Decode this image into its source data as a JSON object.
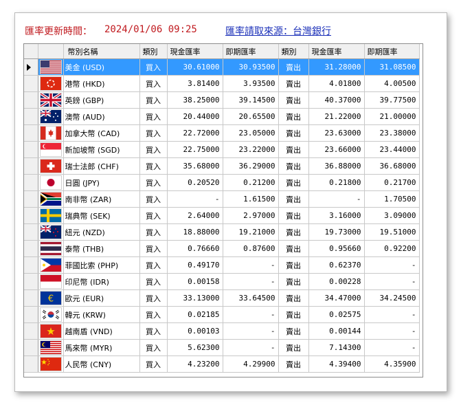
{
  "header": {
    "update_label": "匯率更新時間：",
    "update_time": "2024/01/06  09:25",
    "source_link": "匯率請取來源：台灣銀行"
  },
  "table": {
    "columns": [
      "幣別名稱",
      "類別",
      "現金匯率",
      "即期匯率",
      "類別",
      "現金匯率",
      "即期匯率"
    ],
    "rows": [
      {
        "flag": "us-flag-icon",
        "name": "美金 (USD)",
        "buy_label": "買入",
        "buy_cash": "30.61000",
        "buy_spot": "30.93500",
        "sell_label": "賣出",
        "sell_cash": "31.28000",
        "sell_spot": "31.08500"
      },
      {
        "flag": "hk-flag-icon",
        "name": "港幣 (HKD)",
        "buy_label": "買入",
        "buy_cash": "3.81400",
        "buy_spot": "3.93500",
        "sell_label": "賣出",
        "sell_cash": "4.01800",
        "sell_spot": "4.00500"
      },
      {
        "flag": "gb-flag-icon",
        "name": "英鎊 (GBP)",
        "buy_label": "買入",
        "buy_cash": "38.25000",
        "buy_spot": "39.14500",
        "sell_label": "賣出",
        "sell_cash": "40.37000",
        "sell_spot": "39.77500"
      },
      {
        "flag": "au-flag-icon",
        "name": "澳幣 (AUD)",
        "buy_label": "買入",
        "buy_cash": "20.44000",
        "buy_spot": "20.65500",
        "sell_label": "賣出",
        "sell_cash": "21.22000",
        "sell_spot": "21.00000"
      },
      {
        "flag": "ca-flag-icon",
        "name": "加拿大幣 (CAD)",
        "buy_label": "買入",
        "buy_cash": "22.72000",
        "buy_spot": "23.05000",
        "sell_label": "賣出",
        "sell_cash": "23.63000",
        "sell_spot": "23.38000"
      },
      {
        "flag": "sg-flag-icon",
        "name": "新加坡幣 (SGD)",
        "buy_label": "買入",
        "buy_cash": "22.75000",
        "buy_spot": "23.22000",
        "sell_label": "賣出",
        "sell_cash": "23.66000",
        "sell_spot": "23.44000"
      },
      {
        "flag": "ch-flag-icon",
        "name": "瑞士法郎 (CHF)",
        "buy_label": "買入",
        "buy_cash": "35.68000",
        "buy_spot": "36.29000",
        "sell_label": "賣出",
        "sell_cash": "36.88000",
        "sell_spot": "36.68000"
      },
      {
        "flag": "jp-flag-icon",
        "name": "日圓 (JPY)",
        "buy_label": "買入",
        "buy_cash": "0.20520",
        "buy_spot": "0.21200",
        "sell_label": "賣出",
        "sell_cash": "0.21800",
        "sell_spot": "0.21700"
      },
      {
        "flag": "za-flag-icon",
        "name": "南非幣 (ZAR)",
        "buy_label": "買入",
        "buy_cash": "-",
        "buy_spot": "1.61500",
        "sell_label": "賣出",
        "sell_cash": "-",
        "sell_spot": "1.70500"
      },
      {
        "flag": "se-flag-icon",
        "name": "瑞典幣 (SEK)",
        "buy_label": "買入",
        "buy_cash": "2.64000",
        "buy_spot": "2.97000",
        "sell_label": "賣出",
        "sell_cash": "3.16000",
        "sell_spot": "3.09000"
      },
      {
        "flag": "nz-flag-icon",
        "name": "紐元 (NZD)",
        "buy_label": "買入",
        "buy_cash": "18.88000",
        "buy_spot": "19.21000",
        "sell_label": "賣出",
        "sell_cash": "19.73000",
        "sell_spot": "19.51000"
      },
      {
        "flag": "th-flag-icon",
        "name": "泰幣 (THB)",
        "buy_label": "買入",
        "buy_cash": "0.76660",
        "buy_spot": "0.87600",
        "sell_label": "賣出",
        "sell_cash": "0.95660",
        "sell_spot": "0.92200"
      },
      {
        "flag": "ph-flag-icon",
        "name": "菲國比索 (PHP)",
        "buy_label": "買入",
        "buy_cash": "0.49170",
        "buy_spot": "-",
        "sell_label": "賣出",
        "sell_cash": "0.62370",
        "sell_spot": "-"
      },
      {
        "flag": "id-flag-icon",
        "name": "印尼幣 (IDR)",
        "buy_label": "買入",
        "buy_cash": "0.00158",
        "buy_spot": "-",
        "sell_label": "賣出",
        "sell_cash": "0.00228",
        "sell_spot": "-"
      },
      {
        "flag": "eu-flag-icon",
        "name": "歐元 (EUR)",
        "buy_label": "買入",
        "buy_cash": "33.13000",
        "buy_spot": "33.64500",
        "sell_label": "賣出",
        "sell_cash": "34.47000",
        "sell_spot": "34.24500"
      },
      {
        "flag": "kr-flag-icon",
        "name": "韓元 (KRW)",
        "buy_label": "買入",
        "buy_cash": "0.02185",
        "buy_spot": "-",
        "sell_label": "賣出",
        "sell_cash": "0.02575",
        "sell_spot": "-"
      },
      {
        "flag": "vn-flag-icon",
        "name": "越南盾 (VND)",
        "buy_label": "買入",
        "buy_cash": "0.00103",
        "buy_spot": "-",
        "sell_label": "賣出",
        "sell_cash": "0.00144",
        "sell_spot": "-"
      },
      {
        "flag": "my-flag-icon",
        "name": "馬來幣 (MYR)",
        "buy_label": "買入",
        "buy_cash": "5.62300",
        "buy_spot": "-",
        "sell_label": "賣出",
        "sell_cash": "7.14300",
        "sell_spot": "-"
      },
      {
        "flag": "cn-flag-icon",
        "name": "人民幣 (CNY)",
        "buy_label": "買入",
        "buy_cash": "4.23200",
        "buy_spot": "4.29900",
        "sell_label": "賣出",
        "sell_cash": "4.39400",
        "sell_spot": "4.35900"
      }
    ],
    "selected_row": 0
  },
  "colors": {
    "header_text": "#c0191e",
    "link": "#1a2fb8",
    "selection": "#3399ff"
  }
}
